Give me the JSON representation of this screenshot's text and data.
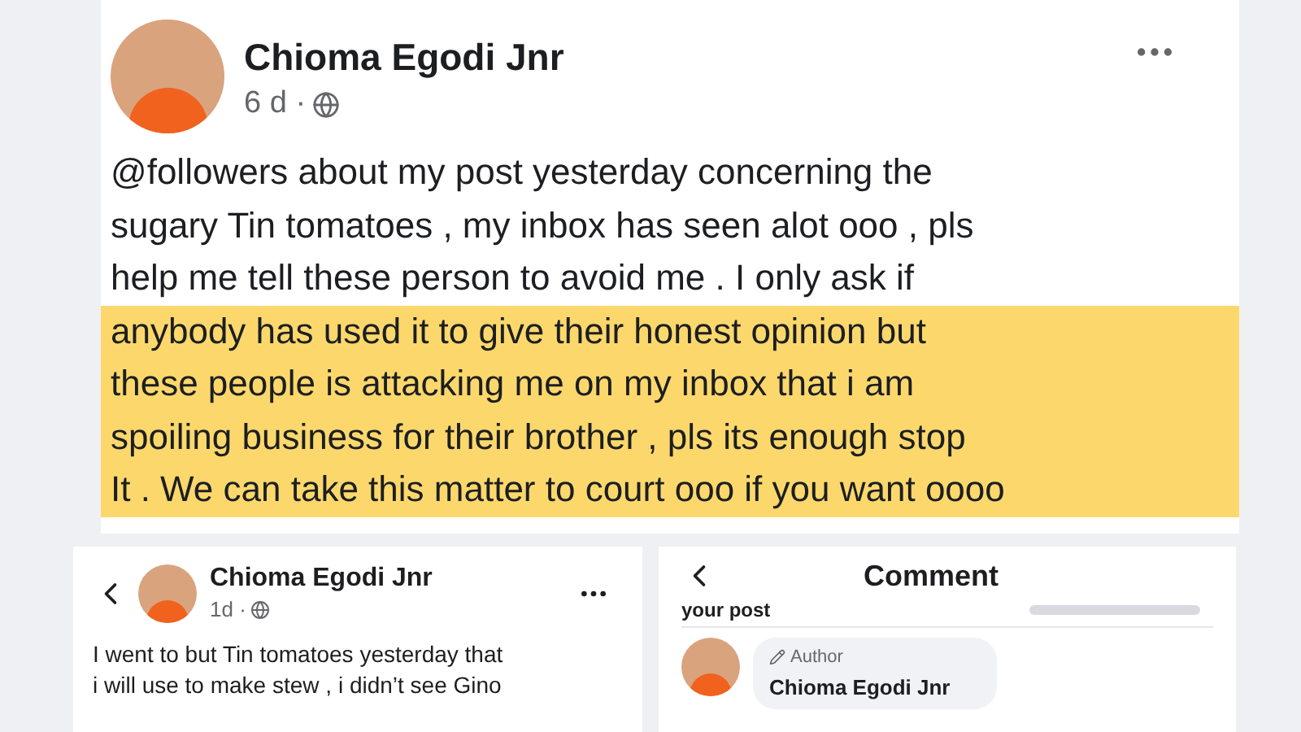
{
  "post": {
    "author": "Chioma Egodi Jnr",
    "time": "6 d ·",
    "lines": [
      {
        "text": "@followers about my post yesterday concerning the",
        "highlighted": false
      },
      {
        "text": "sugary Tin tomatoes , my inbox has seen alot ooo  , pls",
        "highlighted": false
      },
      {
        "text": "help me tell these person to avoid me . I only ask if",
        "highlighted": false
      },
      {
        "text": "anybody has used it to give their honest opinion but",
        "highlighted": true
      },
      {
        "text": "these people is attacking me on my inbox that i am",
        "highlighted": true
      },
      {
        "text": "spoiling business for their brother , pls its enough stop",
        "highlighted": true
      },
      {
        "text": "It . We can take this matter to court ooo if you want oooo",
        "highlighted": true
      }
    ]
  },
  "earlier_post": {
    "author": "Chioma Egodi Jnr",
    "time": "1d ·",
    "lines": [
      "I went to but Tin tomatoes yesterday that",
      "i will use to make stew , i didn’t see Gino"
    ]
  },
  "comment_view": {
    "title": "Comment",
    "snippet": "your post",
    "badge": "Author",
    "commenter": "Chioma Egodi Jnr"
  }
}
